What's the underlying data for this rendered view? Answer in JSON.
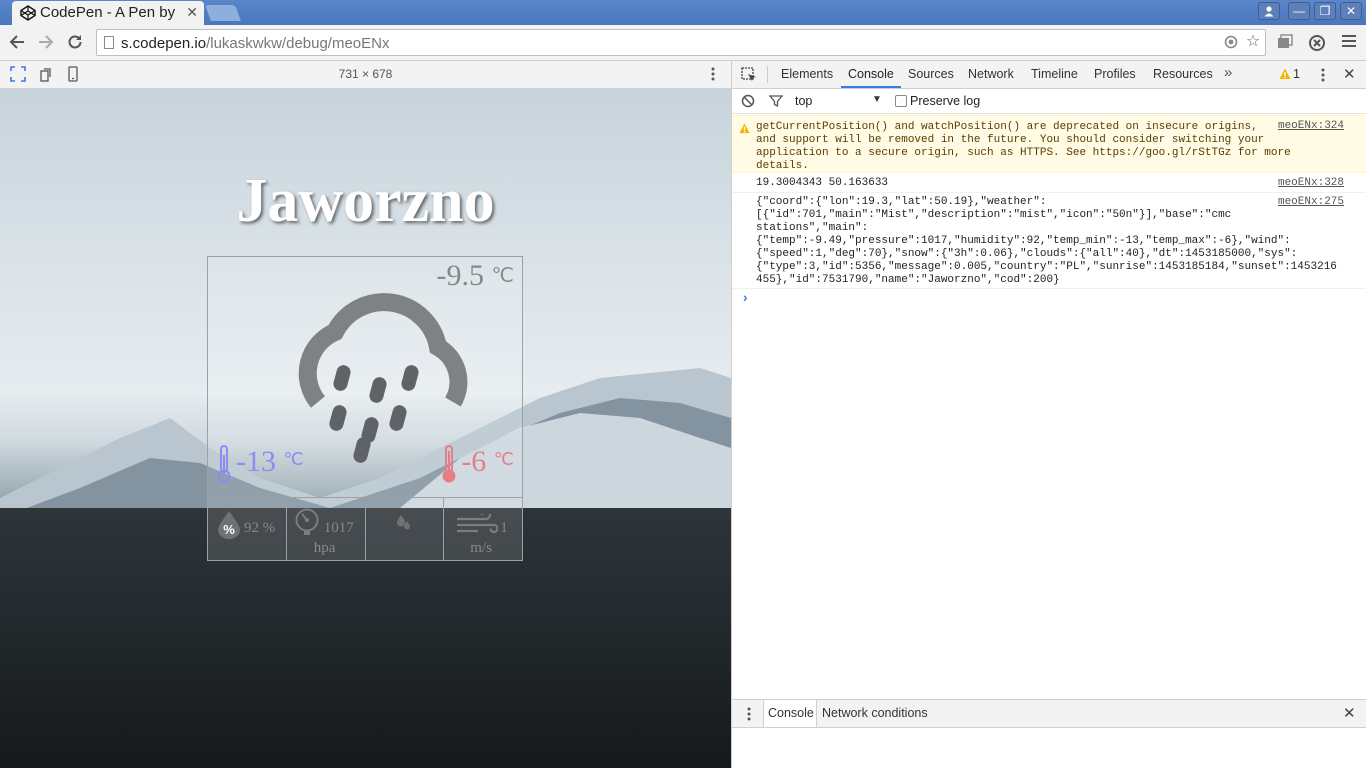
{
  "browser": {
    "tab_title": "CodePen - A Pen by",
    "url_host": "s.codepen.io",
    "url_path": "/lukaskwkw/debug/meoENx"
  },
  "device_toolbar": {
    "dimensions": "731 × 678"
  },
  "weather": {
    "city": "Jaworzno",
    "temp": "-9.5",
    "temp_unit": "℃",
    "temp_min": "-13",
    "temp_max": "-6",
    "humidity": "92 %",
    "pressure": "1017",
    "pressure_unit": "hpa",
    "wind_speed": "1",
    "wind_unit": "m/s"
  },
  "devtools": {
    "tabs": [
      "Elements",
      "Console",
      "Sources",
      "Network",
      "Timeline",
      "Profiles",
      "Resources"
    ],
    "active_tab": "Console",
    "warning_count": "1",
    "filter_context": "top",
    "preserve_log_label": "Preserve log",
    "console": [
      {
        "level": "warning",
        "text": "getCurrentPosition() and watchPosition() are deprecated on insecure origins,\nand support will be removed in the future. You should consider switching your\napplication to a secure origin, such as HTTPS. See https://goo.gl/rStTGz for more\ndetails.",
        "source": "meoENx:324"
      },
      {
        "level": "log",
        "text": "19.3004343 50.163633",
        "source": "meoENx:328"
      },
      {
        "level": "log",
        "text": "{\"coord\":{\"lon\":19.3,\"lat\":50.19},\"weather\":\n[{\"id\":701,\"main\":\"Mist\",\"description\":\"mist\",\"icon\":\"50n\"}],\"base\":\"cmc\nstations\",\"main\":\n{\"temp\":-9.49,\"pressure\":1017,\"humidity\":92,\"temp_min\":-13,\"temp_max\":-6},\"wind\":\n{\"speed\":1,\"deg\":70},\"snow\":{\"3h\":0.06},\"clouds\":{\"all\":40},\"dt\":1453185000,\"sys\":\n{\"type\":3,\"id\":5356,\"message\":0.005,\"country\":\"PL\",\"sunrise\":1453185184,\"sunset\":1453216\n455},\"id\":7531790,\"name\":\"Jaworzno\",\"cod\":200}",
        "source": "meoENx:275"
      }
    ],
    "prompt": "›",
    "drawer_tabs": [
      "Console",
      "Network conditions"
    ]
  },
  "colors": {
    "titlebar": "#4a76bd",
    "accent": "#3b7be9",
    "temp_min": "#8b8cf0",
    "temp_max": "#e67f85",
    "warning_bg": "#fffbe5"
  }
}
